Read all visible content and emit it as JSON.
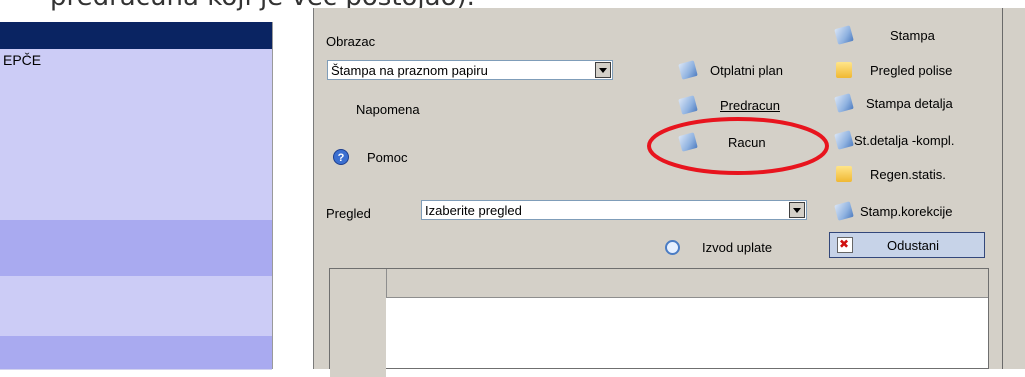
{
  "caption": "predračuna koji je već postojao).",
  "left_list": {
    "rows": [
      {
        "text": "",
        "bg": "#0a2462"
      },
      {
        "text": "EPČE",
        "bg": "#ccccf6"
      },
      {
        "text": "",
        "bg": "#ccccf6"
      },
      {
        "text": "",
        "bg": "#ccccf6"
      },
      {
        "text": "",
        "bg": "#ccccf6"
      },
      {
        "text": "",
        "bg": "#ccccf6"
      },
      {
        "text": "",
        "bg": "#ccccf6"
      },
      {
        "text": "",
        "bg": "#a9aaf0"
      },
      {
        "text": "",
        "bg": "#a9aaf0"
      },
      {
        "text": "",
        "bg": "#ccccf6"
      },
      {
        "text": "",
        "bg": "#ccccf6"
      },
      {
        "text": "",
        "bg": "#a9aaf0"
      }
    ]
  },
  "form": {
    "obrazac_label": "Obrazac",
    "obrazac_value": "Štampa na praznom papiru",
    "napomena_label": "Napomena",
    "pomoc_label": "Pomoc",
    "pregled_label": "Pregled",
    "pregled_value": "Izaberite pregled"
  },
  "buttons": {
    "otplatni_plan": "Otplatni plan",
    "predracun": "Predracun",
    "racun": "Racun",
    "izvod_uplate": "Izvod uplate",
    "stampa": "Stampa",
    "pregled_polise": "Pregled polise",
    "stampa_detalja": "Stampa detalja",
    "st_detalja_kompl": "St.detalja -kompl.",
    "regen_statis": "Regen.statis.",
    "stamp_korekcije": "Stamp.korekcije",
    "odustani": "Odustani"
  },
  "icons": {
    "print": "print-icon",
    "folder": "folder-icon",
    "help": "help-icon",
    "search": "magnifier-icon",
    "cancel": "cancel-icon"
  },
  "colors": {
    "highlight_ellipse": "#e8141e",
    "window_bg": "#d4d0c8",
    "list_selected": "#0a2462"
  }
}
